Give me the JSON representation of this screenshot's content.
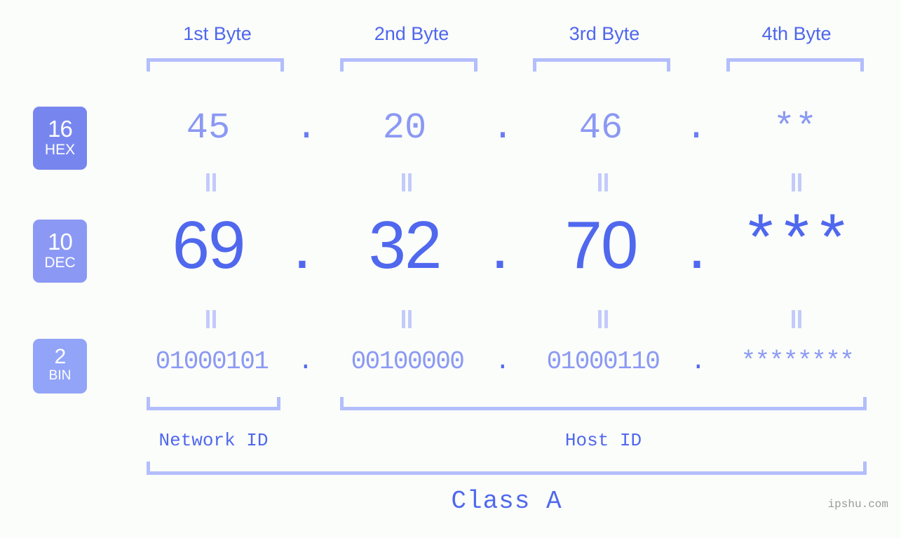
{
  "background_color": "#fbfdfa",
  "accent_colors": {
    "strong_blue": "#5068ee",
    "mid_blue": "#8b99f4",
    "light_blue": "#b3befc",
    "eq_blue": "#c3cbfb",
    "badge_hex": "#7786ef",
    "badge_dec": "#8b99f4",
    "badge_bin": "#92a4f7",
    "watermark_gray": "#9b9b9b"
  },
  "byte_headers": [
    {
      "label": "1st Byte"
    },
    {
      "label": "2nd Byte"
    },
    {
      "label": "3rd Byte"
    },
    {
      "label": "4th Byte"
    }
  ],
  "bases": [
    {
      "number": "16",
      "name": "HEX"
    },
    {
      "number": "10",
      "name": "DEC"
    },
    {
      "number": "2",
      "name": "BIN"
    }
  ],
  "separator": ".",
  "equals_mark": "=",
  "rows": {
    "hex": {
      "base_number": "16",
      "base_name": "HEX",
      "values": [
        "45",
        "20",
        "46",
        "**"
      ]
    },
    "dec": {
      "base_number": "10",
      "base_name": "DEC",
      "values": [
        "69",
        "32",
        "70",
        "***"
      ]
    },
    "bin": {
      "base_number": "2",
      "base_name": "BIN",
      "values": [
        "01000101",
        "00100000",
        "01000110",
        "********"
      ]
    }
  },
  "id_sections": [
    {
      "label": "Network ID"
    },
    {
      "label": "Host ID"
    }
  ],
  "class_label": "Class A",
  "watermark": "ipshu.com"
}
